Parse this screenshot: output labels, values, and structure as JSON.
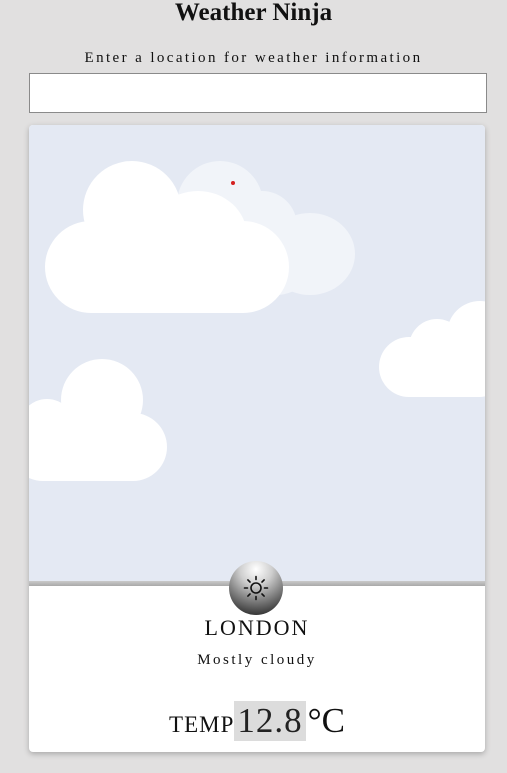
{
  "app": {
    "title": "Weather Ninja",
    "prompt": "Enter a location for weather information"
  },
  "search": {
    "value": "",
    "placeholder": ""
  },
  "weather": {
    "city": "LONDON",
    "description": "Mostly cloudy",
    "temp_label": "TEMP",
    "temp_value": "12.8",
    "temp_unit": "°C",
    "condition_icon": "sun-icon"
  },
  "colors": {
    "sky": "#e4e9f3",
    "cloud": "#ffffff",
    "page_background": "#e1e0e0"
  }
}
